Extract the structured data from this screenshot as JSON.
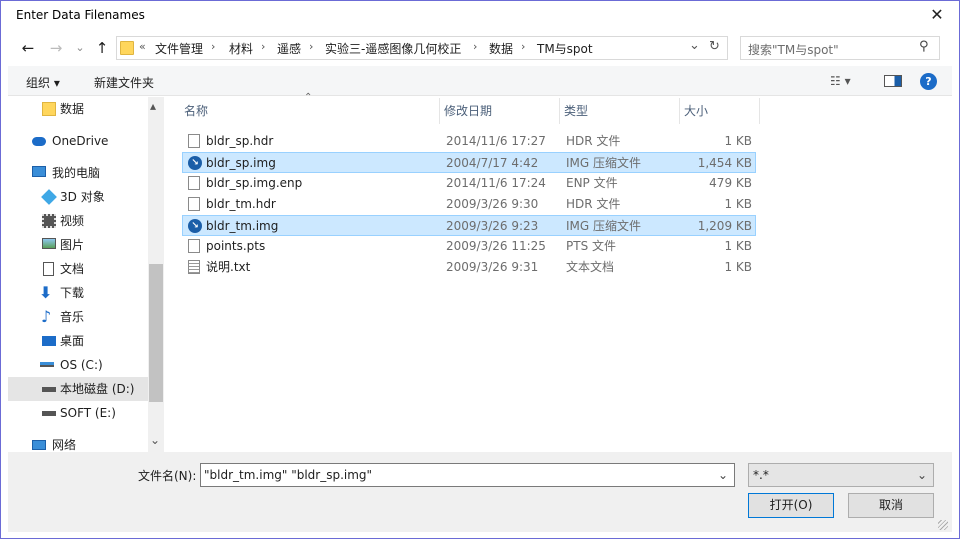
{
  "window": {
    "title": "Enter Data Filenames",
    "close_glyph": "✕"
  },
  "nav": {
    "back": "←",
    "forward": "→",
    "dropdown": "⌄",
    "up": "↑"
  },
  "address": {
    "overflow": "«",
    "crumbs": [
      "文件管理",
      "材料",
      "遥感",
      "实验三-遥感图像几何校正",
      "数据",
      "TM与spot"
    ],
    "sep": "›",
    "dropdown": "⌄",
    "refresh": "↻"
  },
  "search": {
    "placeholder": "搜索\"TM与spot\"",
    "icon": "⚲"
  },
  "toolbar": {
    "organize": "组织 ▾",
    "new_folder": "新建文件夹",
    "view": "☷ ▾",
    "help": "?"
  },
  "navpane": {
    "items": [
      {
        "label": "数据",
        "icon": "folder-icon"
      },
      {
        "label": "OneDrive",
        "icon": "cloud-icon"
      },
      {
        "label": "我的电脑",
        "icon": "computer-icon"
      },
      {
        "label": "3D 对象",
        "icon": "cube-icon"
      },
      {
        "label": "视频",
        "icon": "video-icon"
      },
      {
        "label": "图片",
        "icon": "picture-icon"
      },
      {
        "label": "文档",
        "icon": "document-icon"
      },
      {
        "label": "下载",
        "icon": "download-icon"
      },
      {
        "label": "音乐",
        "icon": "music-icon"
      },
      {
        "label": "桌面",
        "icon": "desktop-icon"
      },
      {
        "label": "OS (C:)",
        "icon": "drive-icon"
      },
      {
        "label": "本地磁盘 (D:)",
        "icon": "drive-icon"
      },
      {
        "label": "SOFT (E:)",
        "icon": "drive-icon"
      },
      {
        "label": "网络",
        "icon": "network-icon"
      }
    ],
    "scroll_up": "▴",
    "scroll_down": "⌄"
  },
  "columns": {
    "name": "名称",
    "date": "修改日期",
    "type": "类型",
    "size": "大小",
    "sort_indicator": "⌃"
  },
  "files": [
    {
      "name": "bldr_sp.hdr",
      "date": "2014/11/6 17:27",
      "type": "HDR 文件",
      "size": "1 KB",
      "icon": "hdr-file-icon",
      "selected": false
    },
    {
      "name": "bldr_sp.img",
      "date": "2004/7/17 4:42",
      "type": "IMG 压缩文件",
      "size": "1,454 KB",
      "icon": "img-file-icon",
      "selected": true
    },
    {
      "name": "bldr_sp.img.enp",
      "date": "2014/11/6 17:24",
      "type": "ENP 文件",
      "size": "479 KB",
      "icon": "blank-file-icon",
      "selected": false
    },
    {
      "name": "bldr_tm.hdr",
      "date": "2009/3/26 9:30",
      "type": "HDR 文件",
      "size": "1 KB",
      "icon": "hdr-file-icon",
      "selected": false
    },
    {
      "name": "bldr_tm.img",
      "date": "2009/3/26 9:23",
      "type": "IMG 压缩文件",
      "size": "1,209 KB",
      "icon": "img-file-icon",
      "selected": true
    },
    {
      "name": "points.pts",
      "date": "2009/3/26 11:25",
      "type": "PTS 文件",
      "size": "1 KB",
      "icon": "blank-file-icon",
      "selected": false
    },
    {
      "name": "说明.txt",
      "date": "2009/3/26 9:31",
      "type": "文本文档",
      "size": "1 KB",
      "icon": "text-file-icon",
      "selected": false
    }
  ],
  "footer": {
    "filename_label": "文件名(N):",
    "filename_value": "\"bldr_tm.img\" \"bldr_sp.img\"",
    "filename_dropdown": "⌄",
    "filter_value": "*.*",
    "filter_dropdown": "⌄",
    "open_label": "打开(O)",
    "cancel_label": "取消"
  },
  "colors": {
    "selection_bg": "#cce8ff",
    "selection_border": "#99d1ff",
    "header_text": "#4c607a",
    "accent": "#0078d7",
    "folder": "#ffd65c"
  }
}
